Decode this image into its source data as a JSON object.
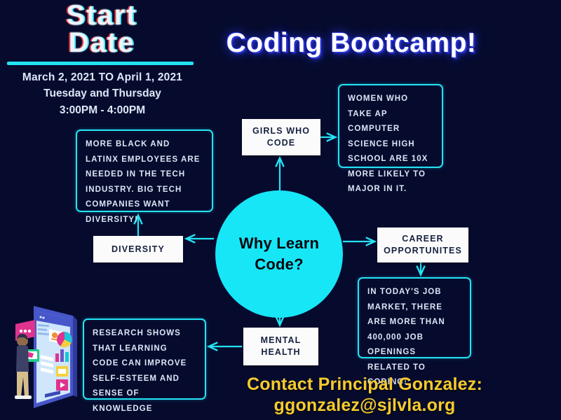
{
  "theme": {
    "background": "#060B2E",
    "cyan": "#24E3F3",
    "circle_fill": "#17E6F7",
    "node_fill": "#FBFBFB",
    "node_text": "#16213F",
    "fact_text": "#DBE6F5",
    "contact_yellow": "#F6CB2B",
    "headline_glow": "#2A35D6"
  },
  "header": {
    "title_line1": "Start",
    "title_line2": "Date",
    "date_range": "March 2, 2021 TO April 1, 2021",
    "days": "Tuesday and Thursday",
    "time": "3:00PM - 4:00PM"
  },
  "headline": {
    "text": "Coding Bootcamp!"
  },
  "diagram": {
    "center": {
      "label_line1": "Why Learn",
      "label_line2": "Code?"
    },
    "nodes": [
      {
        "id": "girls-who-code",
        "label": "GIRLS WHO CODE"
      },
      {
        "id": "diversity",
        "label": "DIVERSITY"
      },
      {
        "id": "career-opportunites",
        "label": "CAREER OPPORTUNITES"
      },
      {
        "id": "mental-health",
        "label": "MENTAL HEALTH"
      }
    ],
    "facts": [
      {
        "id": "women-ap",
        "text": "WOMEN WHO TAKE AP COMPUTER SCIENCE HIGH SCHOOL ARE 10X MORE LIKELY TO MAJOR IN IT."
      },
      {
        "id": "diversity",
        "text": "MORE BLACK AND LATINX EMPLOYEES ARE NEEDED IN THE TECH INDUSTRY.  BIG TECH COMPANIES WANT DIVERSITY!"
      },
      {
        "id": "jobs",
        "text": "IN TODAY'S JOB MARKET, THERE ARE MORE THAN 400,000 JOB OPENINGS RELATED TO CODING!"
      },
      {
        "id": "research",
        "text": "RESEARCH SHOWS THAT LEARNING CODE CAN IMPROVE SELF-ESTEEM AND SENSE OF KNOWLEDGE"
      }
    ]
  },
  "contact": {
    "line1": "Contact Principal Gonzalez:",
    "line2": "ggonzalez@sjlvla.org"
  },
  "illustration": {
    "name": "person-using-mobile-dashboard-illustration"
  }
}
